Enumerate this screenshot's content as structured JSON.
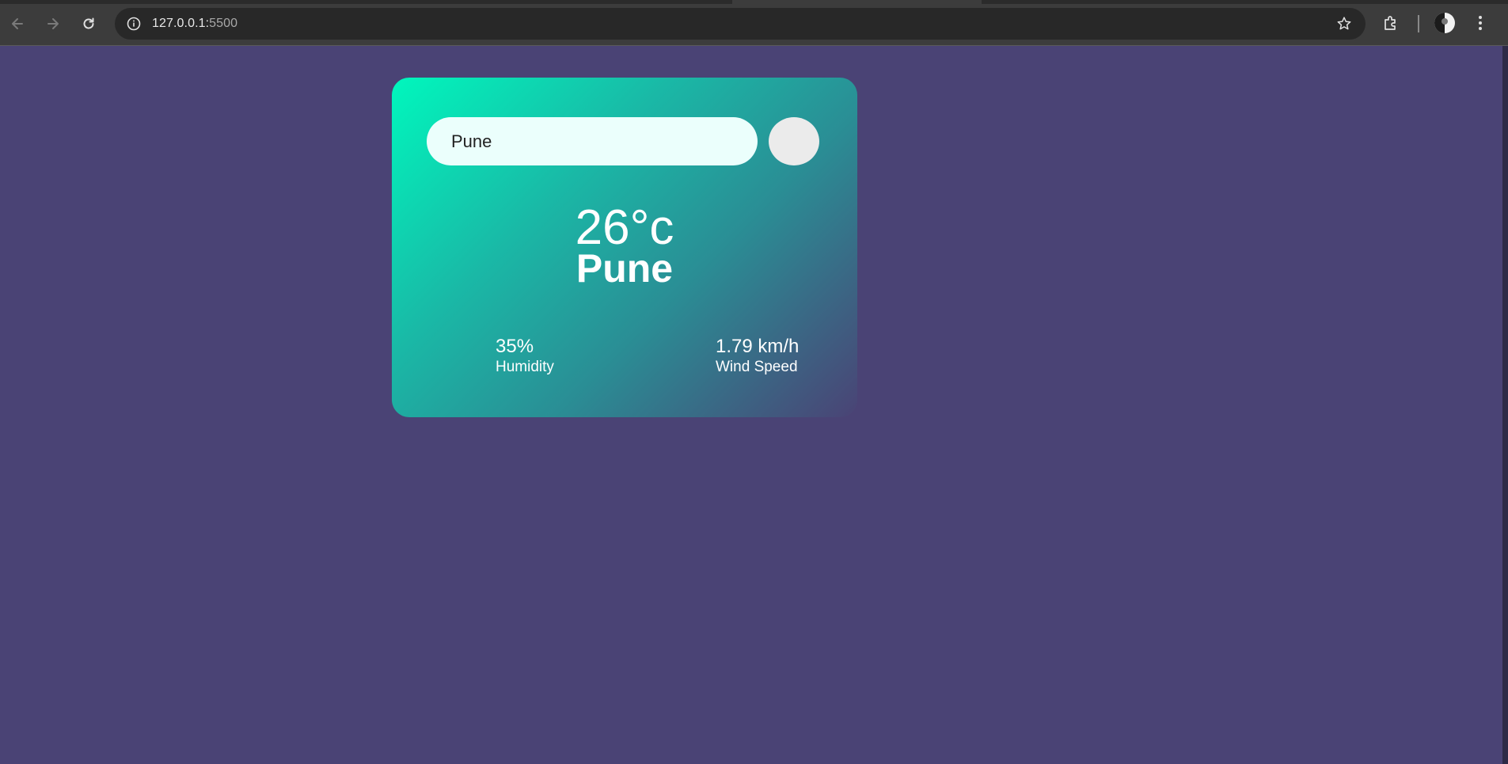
{
  "browser": {
    "url_host": "127.0.0.1:",
    "url_port": "5500"
  },
  "weather": {
    "search": {
      "value": "Pune"
    },
    "temperature": "26°c",
    "city": "Pune",
    "humidity": {
      "value": "35%",
      "label": "Humidity"
    },
    "wind": {
      "value": "1.79 km/h",
      "label": "Wind Speed"
    }
  },
  "colors": {
    "page_background": "#4a4375",
    "card_gradient_start": "#00f7bd",
    "card_gradient_end": "#4a4375",
    "search_input_bg": "#ebfffc",
    "search_button_bg": "#ebebeb"
  },
  "icons": [
    "back-arrow-icon",
    "forward-arrow-icon",
    "reload-icon",
    "info-icon",
    "star-icon",
    "extensions-icon",
    "avatar",
    "more-vert-icon"
  ]
}
